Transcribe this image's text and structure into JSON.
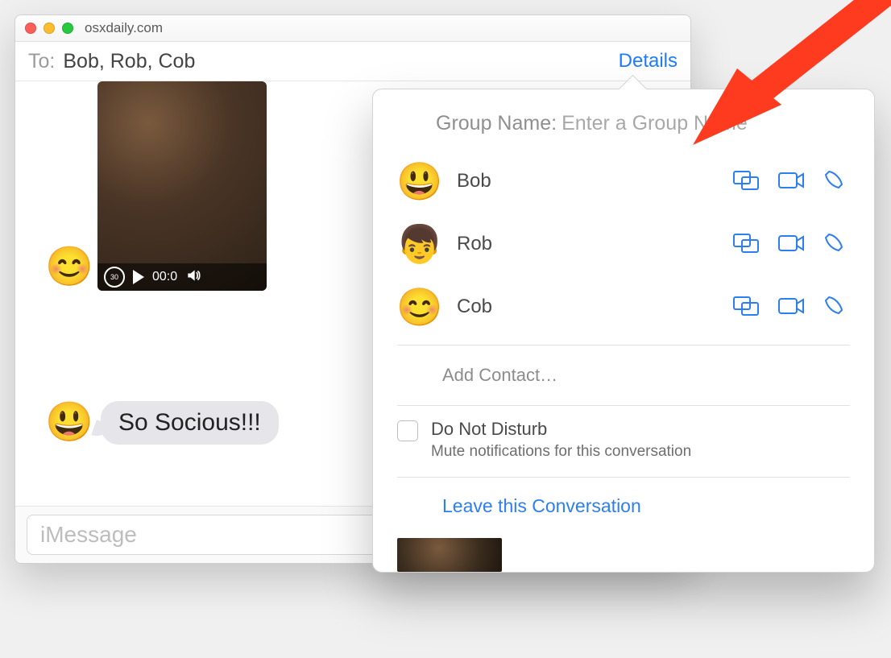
{
  "window": {
    "title": "osxdaily.com",
    "to_label": "To:",
    "to_names": "Bob, Rob, Cob",
    "details_label": "Details"
  },
  "messages": {
    "video": {
      "avatar_emoji": "😊",
      "rewind_seconds": "30",
      "time": "00:0"
    },
    "text": {
      "avatar_emoji": "😃",
      "body": "So Socious!!!"
    }
  },
  "compose": {
    "placeholder": "iMessage",
    "value": ""
  },
  "details_popover": {
    "group_name_label": "Group Name:",
    "group_name_placeholder": "Enter a Group Name",
    "contacts": [
      {
        "name": "Bob",
        "avatar_emoji": "😃"
      },
      {
        "name": "Rob",
        "avatar_emoji": "👦"
      },
      {
        "name": "Cob",
        "avatar_emoji": "😊"
      }
    ],
    "add_contact_label": "Add Contact…",
    "dnd_label": "Do Not Disturb",
    "dnd_sub": "Mute notifications for this conversation",
    "leave_label": "Leave this Conversation"
  },
  "colors": {
    "accent": "#2d7ff0",
    "arrow": "#ff3b1f"
  }
}
